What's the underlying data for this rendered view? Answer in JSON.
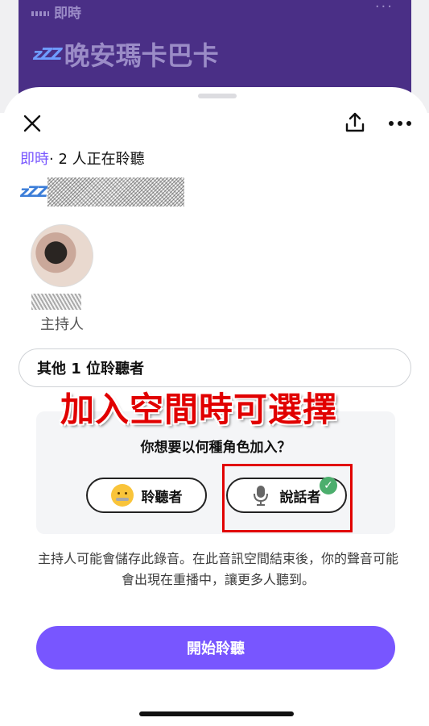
{
  "background_space": {
    "live_label": "即時",
    "title": "晚安瑪卡巴卡",
    "more_label": "···"
  },
  "sheet": {
    "live_label": "即時",
    "listening_count_text": "· 2 人正在聆聽",
    "host_role_label": "主持人",
    "other_listeners_label": "其他 1 位聆聽者",
    "annotation_text": "加入空間時可選擇",
    "role_question": "你想要以何種角色加入？",
    "role_options": [
      "聆聽者",
      "說話者"
    ],
    "selected_role": "說話者",
    "notice_text": "主持人可能會儲存此錄音。在此音訊空間結束後，你的聲音可能會出現在重播中，讓更多人聽到。",
    "start_button_label": "開始聆聽"
  },
  "colors": {
    "accent": "#7856ff",
    "space_card": "#4a2f86",
    "annotation": "#e10000",
    "check": "#4cae6d"
  }
}
